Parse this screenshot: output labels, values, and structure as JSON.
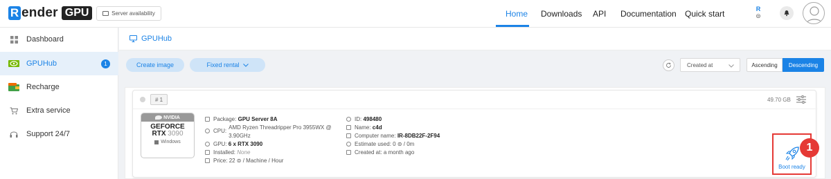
{
  "brand": {
    "r": "R",
    "ender": "ender",
    "gpu": "GPU"
  },
  "header": {
    "server_availability": "Server availability",
    "nav": [
      "Home",
      "Downloads",
      "API",
      "Documentation",
      "Quick start"
    ],
    "active_nav": "Home",
    "lang_top": "R",
    "lang_bottom": "⊜"
  },
  "sidebar": {
    "items": [
      {
        "label": "Dashboard",
        "icon": "grid-icon"
      },
      {
        "label": "GPUHub",
        "icon": "nvidia-icon",
        "badge": "1",
        "active": true
      },
      {
        "label": "Recharge",
        "icon": "wallet-icon"
      },
      {
        "label": "Extra service",
        "icon": "cart-icon"
      },
      {
        "label": "Support 24/7",
        "icon": "headset-icon"
      }
    ]
  },
  "breadcrumb": {
    "title": "GPUHub"
  },
  "toolbar": {
    "create_image": "Create image",
    "fixed_rental": "Fixed rental",
    "sort_by": "Created at",
    "ascending": "Ascending",
    "descending": "Descending",
    "active_order": "Descending"
  },
  "machine": {
    "index": "# 1",
    "disk_size": "49.70 GB",
    "gpu_brand": "NVIDIA",
    "gpu_line1": "GEFORCE",
    "gpu_line2a": "RTX ",
    "gpu_line2b": "3090",
    "os": "Windows",
    "package_label": "Package:",
    "package": "GPU Server 8A",
    "cpu_label": "CPU:",
    "cpu_line1": "AMD Ryzen Threadripper Pro 3955WX @",
    "cpu_line2": "3.90GHz",
    "gpu_label": "GPU:",
    "gpu": "6 x RTX 3090",
    "installed_label": "Installed:",
    "installed": "None",
    "price_label": "Price:",
    "price": "22 ⊜ / Machine / Hour",
    "id_label": "ID:",
    "id": "498480",
    "name_label": "Name:",
    "name": "c4d",
    "computer_label": "Computer name:",
    "computer": "IR-8DB22F-2F94",
    "estimate_label": "Estimate used:",
    "estimate": "0 ⊜  /  0m",
    "created_label": "Created at:",
    "created": "a month ago",
    "boot_label": "Boot ready"
  },
  "annotation": {
    "number": "1",
    "color": "#e53935"
  },
  "colors": {
    "accent": "#1b83e6",
    "highlight": "#e53935"
  }
}
